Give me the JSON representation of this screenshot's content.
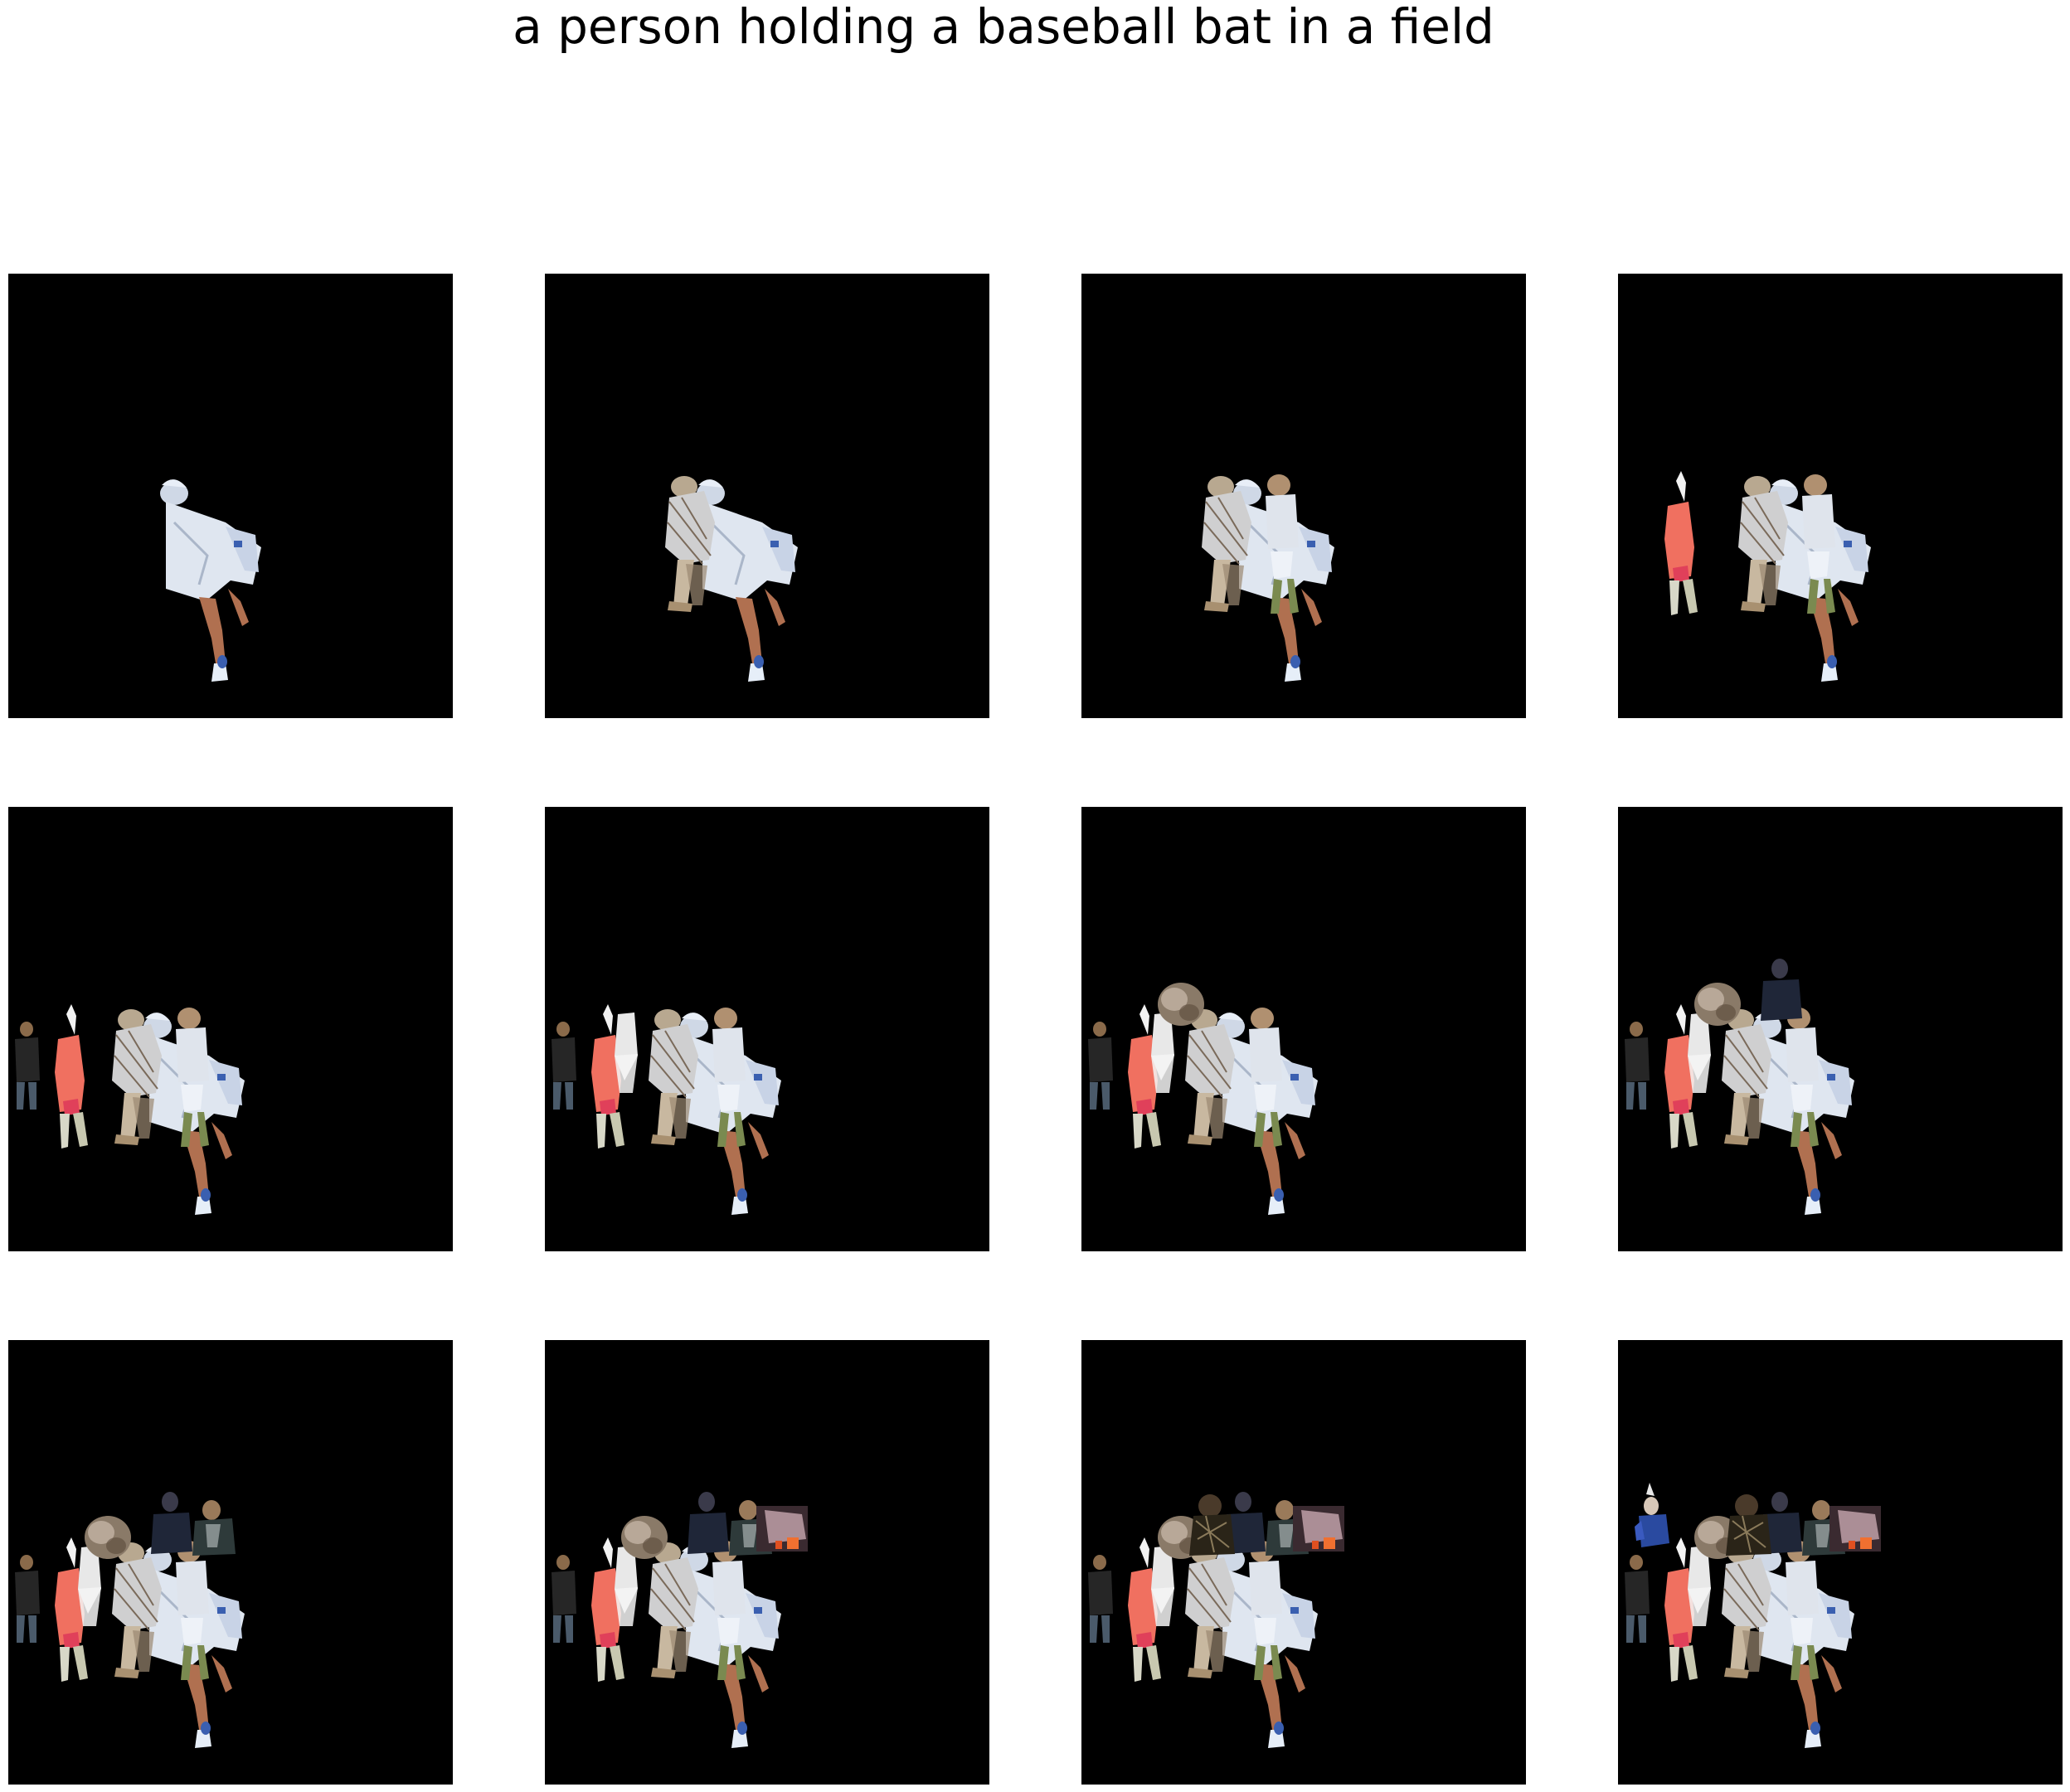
{
  "figure": {
    "title": "a person holding a baseball bat in a field",
    "panel_count": 12,
    "background_color": "#000000",
    "frames": [
      {
        "step": 1,
        "figures": [
          "catcher"
        ]
      },
      {
        "step": 2,
        "figures": [
          "catcher",
          "umpire"
        ]
      },
      {
        "step": 3,
        "figures": [
          "catcher",
          "umpire",
          "batter"
        ]
      },
      {
        "step": 4,
        "figures": [
          "catcher",
          "umpire",
          "batter",
          "pink-player"
        ]
      },
      {
        "step": 5,
        "figures": [
          "catcher",
          "umpire",
          "batter",
          "pink-player",
          "dark-person-left"
        ]
      },
      {
        "step": 6,
        "figures": [
          "catcher",
          "umpire",
          "batter",
          "pink-player",
          "dark-person-left",
          "white-figure"
        ]
      },
      {
        "step": 7,
        "figures": [
          "catcher",
          "umpire",
          "batter",
          "pink-player",
          "dark-person-left",
          "white-figure",
          "blurred-head"
        ]
      },
      {
        "step": 8,
        "figures": [
          "catcher",
          "umpire",
          "batter",
          "pink-player",
          "dark-person-left",
          "white-figure",
          "blurred-head",
          "dark-person-top"
        ]
      },
      {
        "step": 9,
        "figures": [
          "catcher",
          "umpire",
          "batter",
          "pink-player",
          "dark-person-left",
          "white-figure",
          "blurred-head",
          "dark-person-top",
          "spectator"
        ]
      },
      {
        "step": 10,
        "figures": [
          "catcher",
          "umpire",
          "batter",
          "pink-player",
          "dark-person-left",
          "white-figure",
          "blurred-head",
          "dark-person-top",
          "spectator",
          "crowd-strip"
        ]
      },
      {
        "step": 11,
        "figures": [
          "catcher",
          "umpire",
          "batter",
          "pink-player",
          "dark-person-left",
          "white-figure",
          "blurred-head",
          "dark-person-top",
          "spectator",
          "crowd-strip",
          "dark-pattern-figure"
        ]
      },
      {
        "step": 12,
        "figures": [
          "catcher",
          "umpire",
          "batter",
          "pink-player",
          "dark-person-left",
          "white-figure",
          "blurred-head",
          "dark-person-top",
          "spectator",
          "crowd-strip",
          "dark-pattern-figure",
          "blue-shirt-figure"
        ]
      }
    ]
  }
}
